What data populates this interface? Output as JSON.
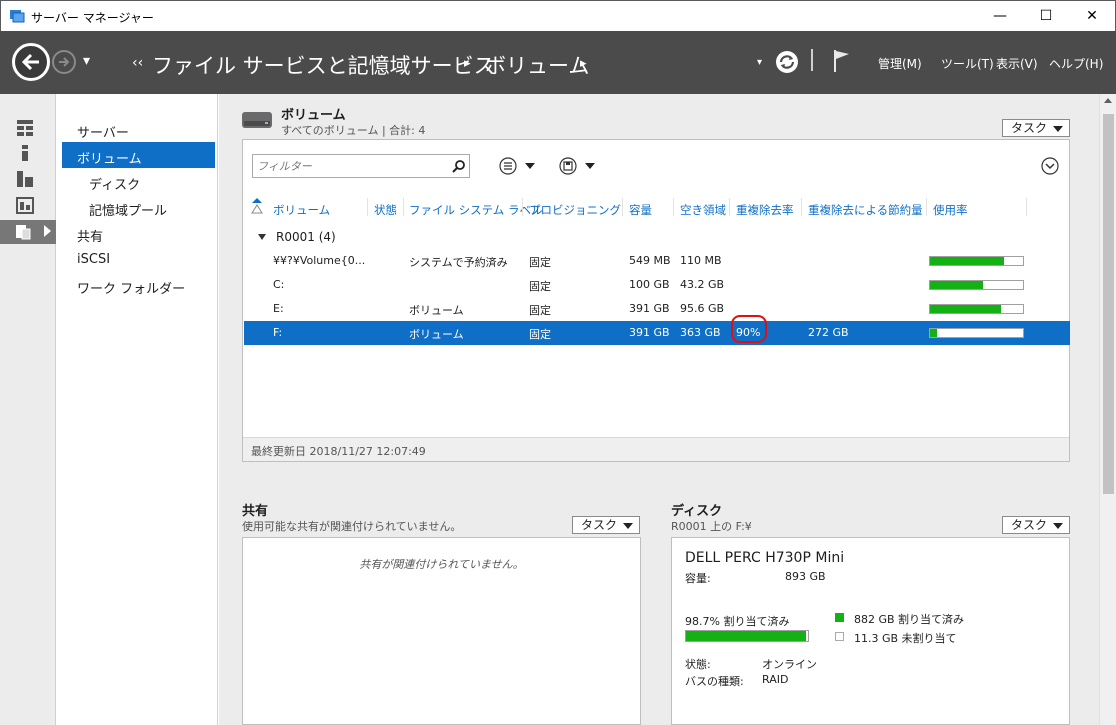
{
  "window": {
    "title": "サーバー マネージャー",
    "minimize": "—",
    "maximize": "☐",
    "close": "✕"
  },
  "nav": {
    "back_arrow": "←",
    "forward_arrow": "→",
    "history_caret": "▾",
    "breadcrumb_lead": "‹‹",
    "breadcrumb": [
      "ファイル サービスと記憶域サービス",
      "ボリューム"
    ],
    "breadcrumb_sep": "▸",
    "menu": [
      "管理(M)",
      "ツール(T)",
      "表示(V)",
      "ヘルプ(H)"
    ]
  },
  "sidebar": {
    "items": [
      {
        "label": "サーバー"
      },
      {
        "label": "ボリューム"
      },
      {
        "label": "ディスク"
      },
      {
        "label": "記憶域プール"
      },
      {
        "label": "共有"
      },
      {
        "label": "iSCSI"
      },
      {
        "label": "ワーク フォルダー"
      }
    ]
  },
  "volumes": {
    "title": "ボリューム",
    "subtitle": "すべてのボリューム | 合計: 4",
    "task_label": "タスク",
    "filter_placeholder": "フィルター",
    "columns": [
      "ボリューム",
      "状態",
      "ファイル システム ラベル",
      "プロビジョニング",
      "容量",
      "空き領域",
      "重複除去率",
      "重複除去による節約量",
      "使用率"
    ],
    "group_label": "R0001 (4)",
    "rows": [
      {
        "volume": "¥¥?¥Volume{0...",
        "status": "",
        "label": "システムで予約済み",
        "provisioning": "固定",
        "capacity": "549 MB",
        "free": "110 MB",
        "dedup_rate": "",
        "dedup_savings": "",
        "usage_fraction": 0.8,
        "selected": false
      },
      {
        "volume": "C:",
        "status": "",
        "label": "",
        "provisioning": "固定",
        "capacity": "100 GB",
        "free": "43.2 GB",
        "dedup_rate": "",
        "dedup_savings": "",
        "usage_fraction": 0.57,
        "selected": false
      },
      {
        "volume": "E:",
        "status": "",
        "label": "ボリューム",
        "provisioning": "固定",
        "capacity": "391 GB",
        "free": "95.6 GB",
        "dedup_rate": "",
        "dedup_savings": "",
        "usage_fraction": 0.76,
        "selected": false
      },
      {
        "volume": "F:",
        "status": "",
        "label": "ボリューム",
        "provisioning": "固定",
        "capacity": "391 GB",
        "free": "363 GB",
        "dedup_rate": "90%",
        "dedup_savings": "272 GB",
        "usage_fraction": 0.07,
        "selected": true
      }
    ],
    "last_updated": "最終更新日 2018/11/27 12:07:49"
  },
  "shares": {
    "title": "共有",
    "subtitle": "使用可能な共有が関連付けられていません。",
    "task_label": "タスク",
    "empty_message": "共有が関連付けられていません。"
  },
  "disk": {
    "title": "ディスク",
    "subtitle": "R0001 上の F:¥",
    "task_label": "タスク",
    "name": "DELL PERC H730P Mini",
    "capacity_label": "容量:",
    "capacity_value": "893 GB",
    "allocated_text": "98.7% 割り当て済み",
    "allocated_fraction": 0.987,
    "legend_allocated": "882 GB 割り当て済み",
    "legend_unallocated": "11.3 GB 未割り当て",
    "status_label": "状態:",
    "status_value": "オンライン",
    "bus_label": "バスの種類:",
    "bus_value": "RAID"
  },
  "colors": {
    "accent": "#0f6fc6",
    "selection": "#0f6fc6",
    "bar_fill": "#13b113",
    "nav_bg": "#4b4b4b",
    "highlight_circle": "#e01010"
  }
}
